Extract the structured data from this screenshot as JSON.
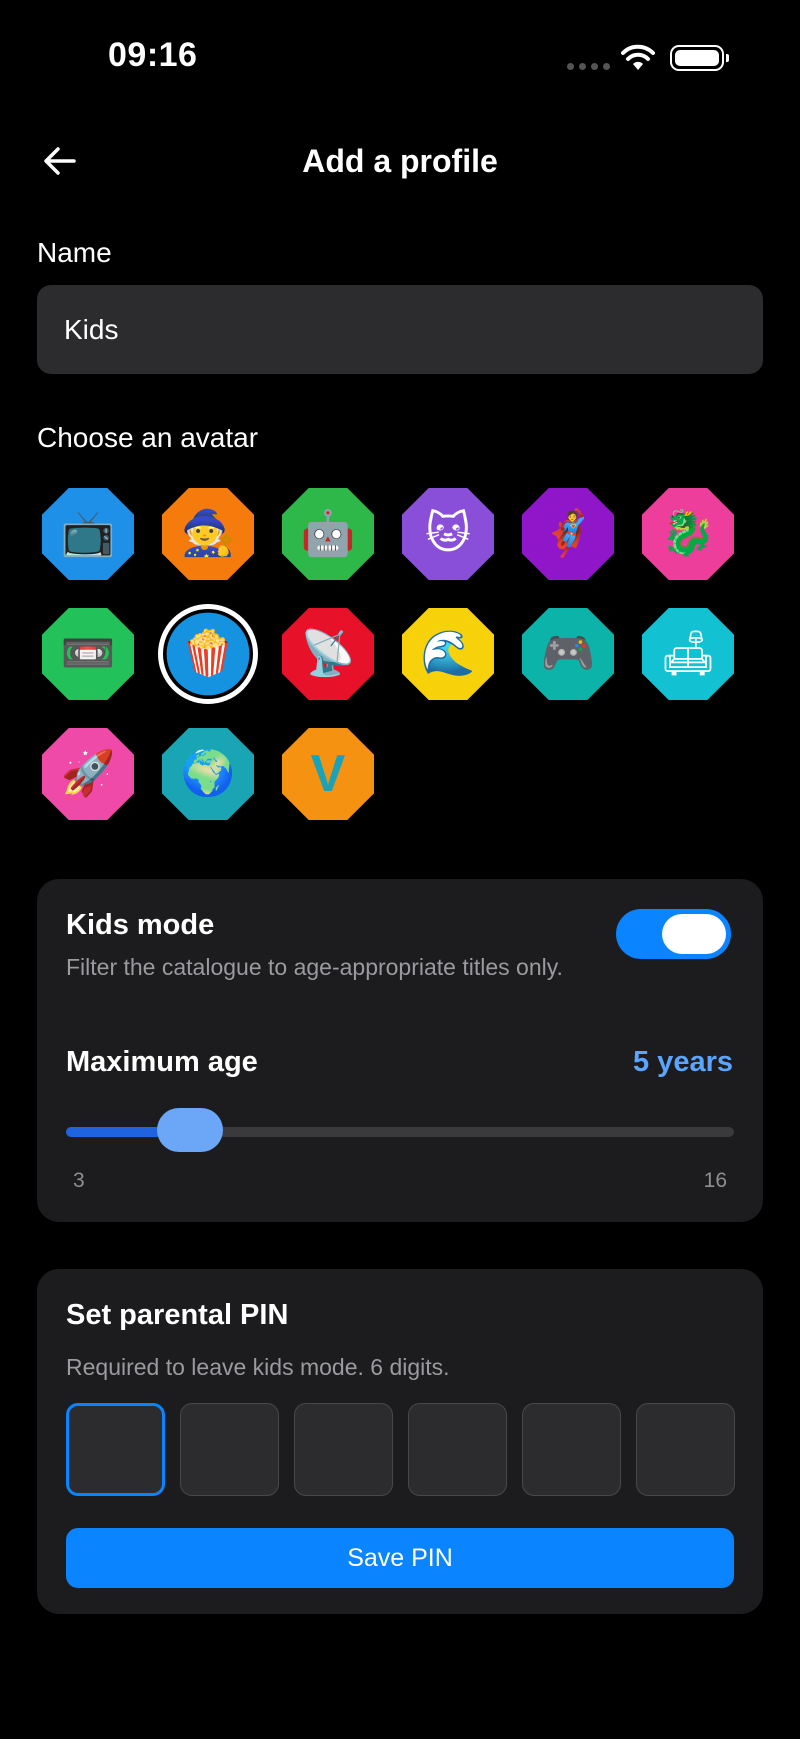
{
  "status": {
    "time": "09:16"
  },
  "header": {
    "title": "Add a profile",
    "back_icon": "arrow-left-icon"
  },
  "name": {
    "label": "Name",
    "value": "Kids"
  },
  "avatars": {
    "label": "Choose an avatar",
    "selected_index": 7,
    "items": [
      {
        "name": "flying-tv-avatar",
        "bg": "#1e90e8",
        "glyph": "📺"
      },
      {
        "name": "wizard-avatar",
        "bg": "#f57c0c",
        "glyph": "🧙"
      },
      {
        "name": "robot-avatar",
        "bg": "#2eb84a",
        "glyph": "🤖"
      },
      {
        "name": "vr-cat-avatar",
        "bg": "#8a4fd8",
        "glyph": "🐱"
      },
      {
        "name": "superhero-avatar",
        "bg": "#8f17c9",
        "glyph": "🦸"
      },
      {
        "name": "dragon-avatar",
        "bg": "#ec3e9a",
        "glyph": "🐉"
      },
      {
        "name": "cassette-avatar",
        "bg": "#23c15a",
        "glyph": "📼"
      },
      {
        "name": "popcorn-avatar",
        "bg": "#1592e0",
        "glyph": "🍿"
      },
      {
        "name": "satellite-dish-avatar",
        "bg": "#e8112a",
        "glyph": "📡"
      },
      {
        "name": "wave-avatar",
        "bg": "#f7d20a",
        "glyph": "🌊"
      },
      {
        "name": "gamepad-avatar",
        "bg": "#0bb3a8",
        "glyph": "🎮"
      },
      {
        "name": "couch-tv-avatar",
        "bg": "#12c2d2",
        "glyph": "🛋"
      },
      {
        "name": "rocket-avatar",
        "bg": "#f04aa8",
        "glyph": "🚀"
      },
      {
        "name": "globe-avatar",
        "bg": "#1aa5b5",
        "glyph": "🌍"
      },
      {
        "name": "letter-v-avatar",
        "bg": "#f59212",
        "glyph": "V"
      }
    ]
  },
  "kids_mode": {
    "title": "Kids mode",
    "description": "Filter the catalogue to age-appropriate titles only.",
    "enabled": true,
    "max_age_label": "Maximum age",
    "max_age_value": "5 years",
    "age": 5,
    "age_min": 3,
    "age_max": 16,
    "min_label": "3",
    "max_label": "16"
  },
  "pin": {
    "title": "Set parental PIN",
    "description": "Required to leave kids mode. 6 digits.",
    "digits": [
      "",
      "",
      "",
      "",
      "",
      ""
    ],
    "save_label": "Save PIN"
  },
  "colors": {
    "accent": "#0a84ff",
    "card": "#1c1c1e",
    "field": "#2c2c2e"
  }
}
